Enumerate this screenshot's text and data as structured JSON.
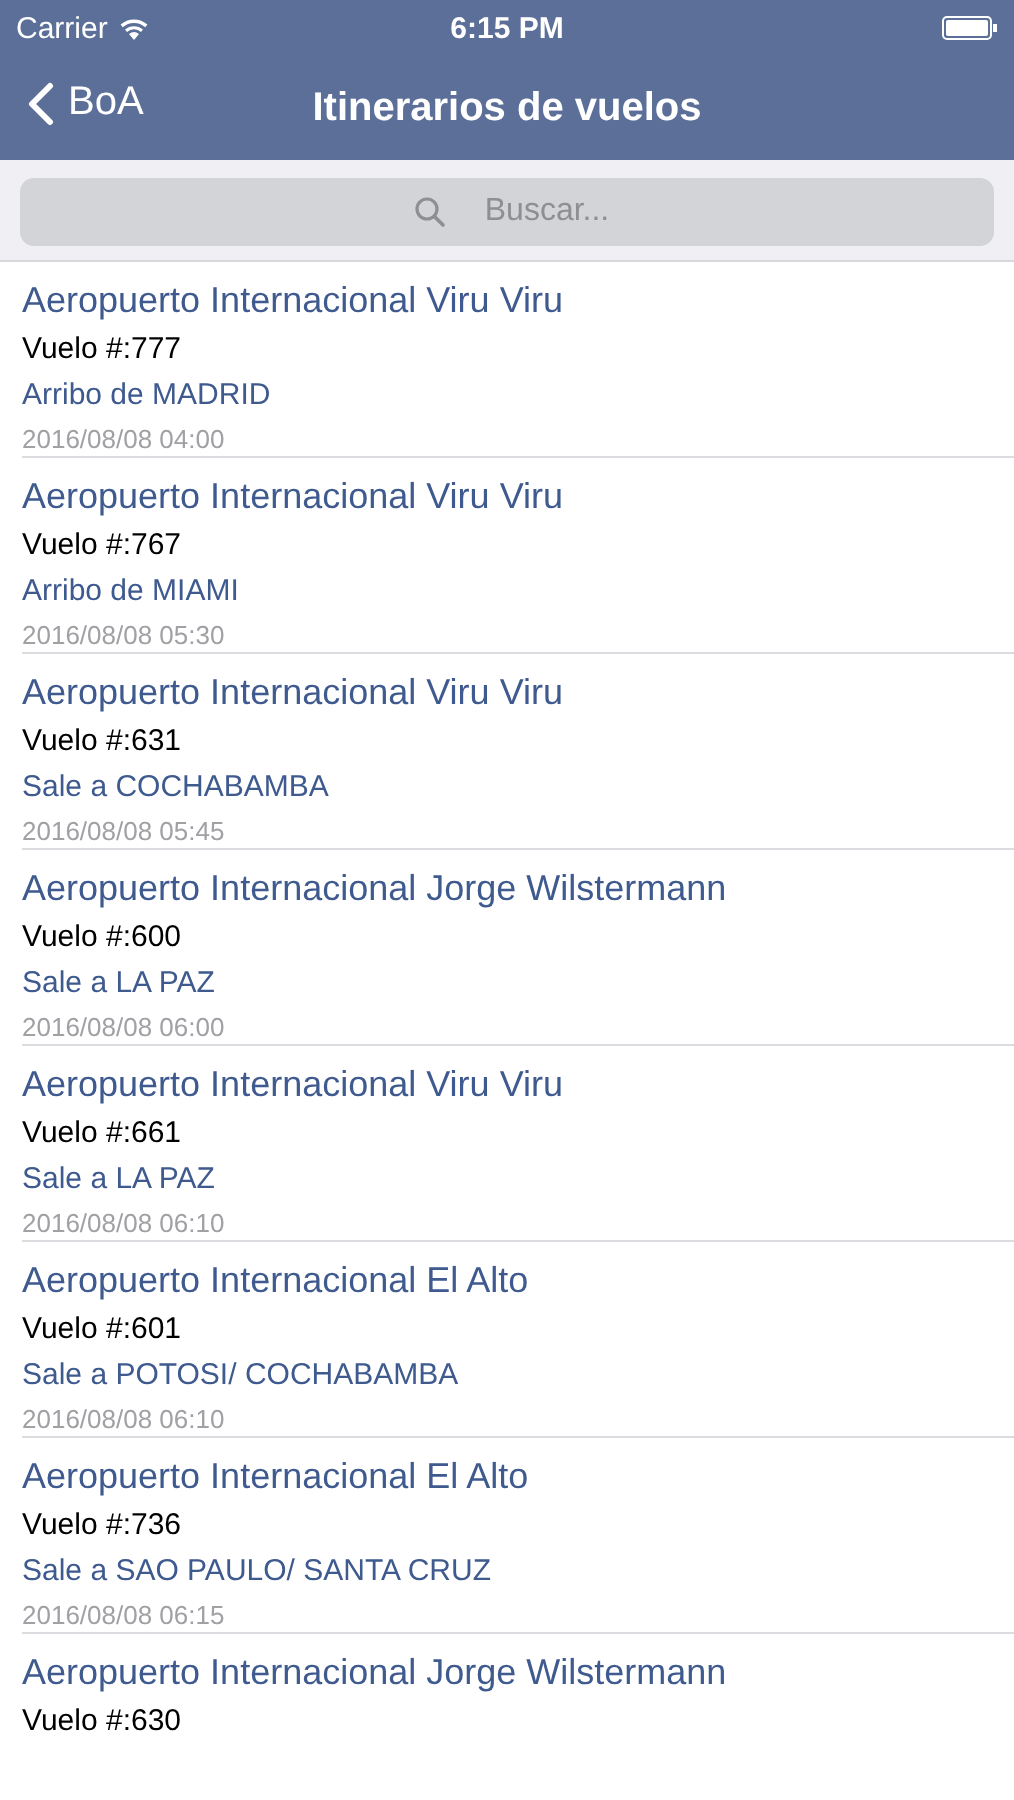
{
  "status_bar": {
    "carrier": "Carrier",
    "time": "6:15 PM"
  },
  "nav": {
    "back": "BoA",
    "title": "Itinerarios de vuelos"
  },
  "search": {
    "placeholder": "Buscar..."
  },
  "flights": [
    {
      "airport": "Aeropuerto Internacional Viru Viru",
      "flight": "Vuelo #:777",
      "route": "Arribo de MADRID",
      "date": "2016/08/08 04:00"
    },
    {
      "airport": "Aeropuerto Internacional Viru Viru",
      "flight": "Vuelo #:767",
      "route": "Arribo de MIAMI",
      "date": "2016/08/08 05:30"
    },
    {
      "airport": "Aeropuerto Internacional Viru Viru",
      "flight": "Vuelo #:631",
      "route": "Sale a COCHABAMBA",
      "date": "2016/08/08 05:45"
    },
    {
      "airport": "Aeropuerto Internacional Jorge Wilstermann",
      "flight": "Vuelo #:600",
      "route": "Sale a LA PAZ",
      "date": "2016/08/08 06:00"
    },
    {
      "airport": "Aeropuerto Internacional Viru Viru",
      "flight": "Vuelo #:661",
      "route": "Sale a LA PAZ",
      "date": "2016/08/08 06:10"
    },
    {
      "airport": "Aeropuerto Internacional El Alto",
      "flight": "Vuelo #:601",
      "route": "Sale a POTOSI/ COCHABAMBA",
      "date": "2016/08/08 06:10"
    },
    {
      "airport": "Aeropuerto Internacional El Alto",
      "flight": "Vuelo #:736",
      "route": "Sale a SAO PAULO/ SANTA CRUZ",
      "date": "2016/08/08 06:15"
    },
    {
      "airport": "Aeropuerto Internacional Jorge Wilstermann",
      "flight": "Vuelo #:630"
    }
  ]
}
